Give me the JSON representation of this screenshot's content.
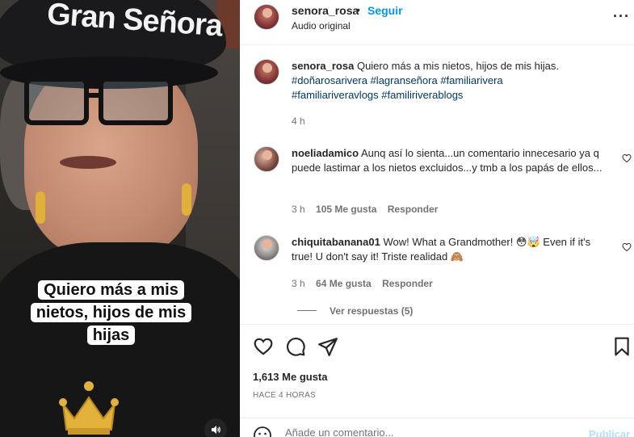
{
  "video": {
    "cap_text": "Gran Señora",
    "caption_lines": [
      "Quiero más a mis",
      "nietos, hijos de mis",
      "hijas"
    ]
  },
  "header": {
    "username": "senora_rosa",
    "separator": "•",
    "follow_label": "Seguir",
    "audio": "Audio original",
    "more_label": "···"
  },
  "post": {
    "username": "senora_rosa",
    "text": "Quiero más a mis nietos, hijos de mis hijas.",
    "hashtags": [
      "#doñarosarivera",
      "#lagranseñora",
      "#familiarivera",
      "#familiariveravlogs",
      "#familiriverablogs"
    ],
    "time": "4 h"
  },
  "comments": [
    {
      "username": "noeliadamico",
      "text": "Aunq así lo sienta...un comentario innecesario ya q puede lastimar a los nietos excluidos...y tmb a los papás de ellos...",
      "time": "3 h",
      "likes": "105 Me gusta",
      "reply": "Responder"
    },
    {
      "username": "chiquitabanana01",
      "text": "Wow! What a Grandmother! 😳🤯 Even if it's true! U don't say it! Triste realidad 🙈",
      "time": "3 h",
      "likes": "64 Me gusta",
      "reply": "Responder"
    }
  ],
  "view_replies": "Ver respuestas (5)",
  "actions": {
    "likes": "1,613 Me gusta",
    "time": "HACE 4 HORAS"
  },
  "add_comment": {
    "placeholder": "Añade un comentario...",
    "publish": "Publicar"
  },
  "colors": {
    "accent": "#0095f6",
    "hashtag": "#00376b",
    "muted": "#737373",
    "publish_disabled": "#b2dffc"
  }
}
